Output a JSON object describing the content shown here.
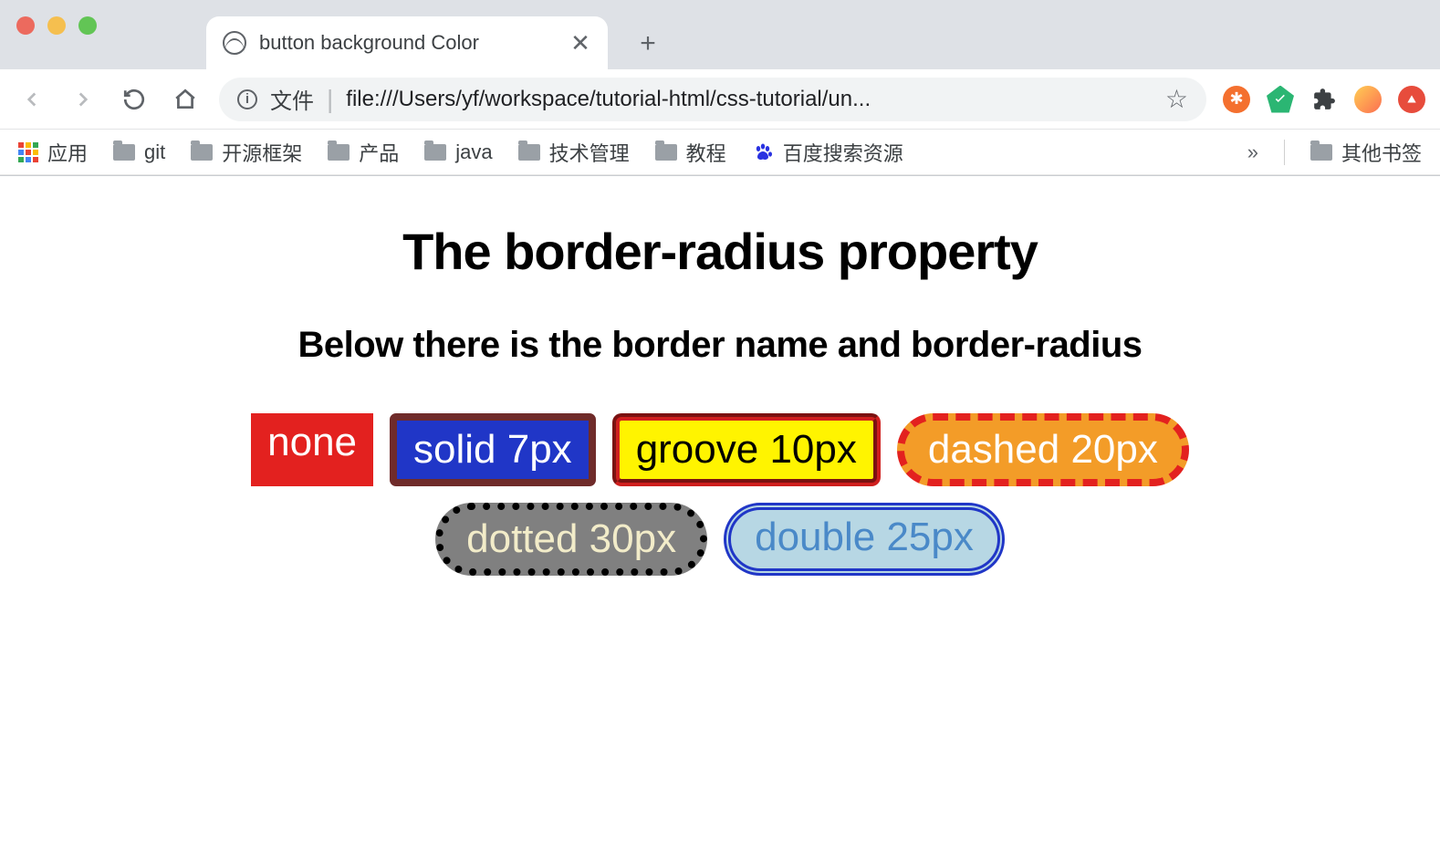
{
  "tab": {
    "title": "button background Color"
  },
  "toolbar": {
    "file_label": "文件",
    "url": "file:///Users/yf/workspace/tutorial-html/css-tutorial/un..."
  },
  "bookmarks": {
    "apps": "应用",
    "items": [
      "git",
      "开源框架",
      "产品",
      "java",
      "技术管理",
      "教程"
    ],
    "baidu": "百度搜索资源",
    "other": "其他书签"
  },
  "page": {
    "h1": "The border-radius property",
    "h2": "Below there is the border name and border-radius",
    "chips": {
      "none": "none",
      "solid": "solid 7px",
      "groove": "groove 10px",
      "dashed": "dashed 20px",
      "dotted": "dotted 30px",
      "double": "double 25px"
    }
  }
}
